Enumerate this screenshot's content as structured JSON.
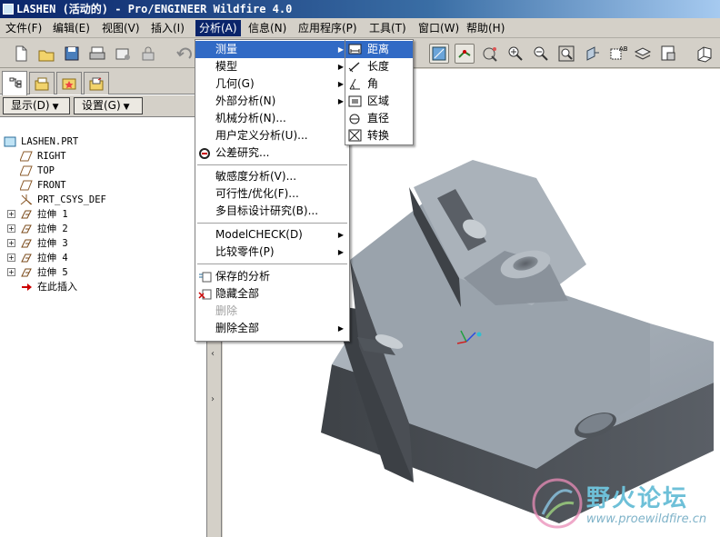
{
  "window": {
    "title": "LASHEN (活动的) - Pro/ENGINEER Wildfire 4.0"
  },
  "menubar": [
    "文件(F)",
    "编辑(E)",
    "视图(V)",
    "插入(I)",
    "分析(A)",
    "信息(N)",
    "应用程序(P)",
    "工具(T)",
    "窗口(W)",
    "帮助(H)"
  ],
  "nav": {
    "show_label": "显示(D)",
    "settings_label": "设置(G)"
  },
  "tree": [
    {
      "label": "LASHEN.PRT",
      "icon": "part-icon",
      "expandable": false
    },
    {
      "label": "RIGHT",
      "icon": "datum-plane-icon",
      "expandable": false
    },
    {
      "label": "TOP",
      "icon": "datum-plane-icon",
      "expandable": false
    },
    {
      "label": "FRONT",
      "icon": "datum-plane-icon",
      "expandable": false
    },
    {
      "label": "PRT_CSYS_DEF",
      "icon": "csys-icon",
      "expandable": false
    },
    {
      "label": "拉伸 1",
      "icon": "extrude-icon",
      "expandable": true
    },
    {
      "label": "拉伸 2",
      "icon": "extrude-icon",
      "expandable": true
    },
    {
      "label": "拉伸 3",
      "icon": "extrude-icon",
      "expandable": true
    },
    {
      "label": "拉伸 4",
      "icon": "extrude-icon",
      "expandable": true
    },
    {
      "label": "拉伸 5",
      "icon": "extrude-icon",
      "expandable": true
    },
    {
      "label": "在此插入",
      "icon": "insert-here-icon",
      "expandable": false
    }
  ],
  "analysis_menu": {
    "items": [
      {
        "label": "测量",
        "submenu": true,
        "highlight": true
      },
      {
        "label": "模型",
        "submenu": true
      },
      {
        "label": "几何(G)",
        "submenu": true
      },
      {
        "label": "外部分析(N)",
        "submenu": true
      },
      {
        "label": "机械分析(N)...",
        "submenu": false
      },
      {
        "label": "用户定义分析(U)...",
        "submenu": false
      },
      {
        "label": "公差研究...",
        "submenu": false,
        "icon": "tolerance-icon"
      },
      {
        "label": "敏感度分析(V)...",
        "submenu": false
      },
      {
        "label": "可行性/优化(F)...",
        "submenu": false
      },
      {
        "label": "多目标设计研究(B)...",
        "submenu": false
      },
      {
        "label": "ModelCHECK(D)",
        "submenu": true
      },
      {
        "label": "比较零件(P)",
        "submenu": true
      },
      {
        "label": "保存的分析",
        "submenu": false,
        "icon": "saved-analysis-icon"
      },
      {
        "label": "隐藏全部",
        "submenu": false,
        "icon": "hide-all-icon"
      },
      {
        "label": "删除",
        "submenu": false,
        "disabled": true
      },
      {
        "label": "删除全部",
        "submenu": true
      }
    ]
  },
  "measure_submenu": {
    "items": [
      {
        "label": "距离",
        "icon": "distance-icon",
        "highlight": true
      },
      {
        "label": "长度",
        "icon": "length-icon"
      },
      {
        "label": "角",
        "icon": "angle-icon"
      },
      {
        "label": "区域",
        "icon": "area-icon"
      },
      {
        "label": "直径",
        "icon": "diameter-icon"
      },
      {
        "label": "转换",
        "icon": "transform-icon"
      }
    ]
  },
  "watermark": {
    "cn": "野火论坛",
    "url": "www.proewildfire.cn"
  },
  "colors": {
    "title_bar": "#0a246a",
    "menu_highlight": "#316ac5",
    "model_top": "#a3acb5",
    "model_shadow": "#4b4f55"
  }
}
